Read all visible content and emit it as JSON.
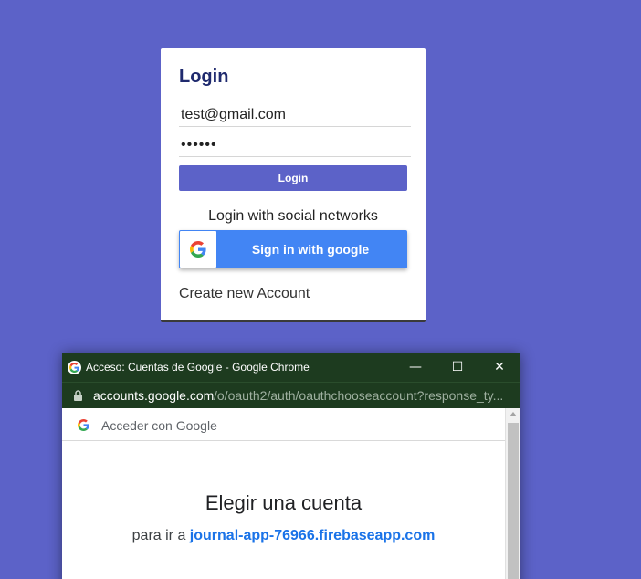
{
  "login_card": {
    "title": "Login",
    "email_value": "test@gmail.com",
    "password_value": "••••••",
    "login_button": "Login",
    "social_label": "Login with social networks",
    "google_button": "Sign in with google",
    "create_account": "Create new Account"
  },
  "popup": {
    "window_title": "Acceso: Cuentas de Google - Google Chrome",
    "minimize_glyph": "—",
    "maximize_glyph": "☐",
    "close_glyph": "✕",
    "url_domain": "accounts.google.com",
    "url_path": "/o/oauth2/auth/oauthchooseaccount?response_ty...",
    "header_text": "Acceder con Google",
    "choose_title": "Elegir una cuenta",
    "continue_prefix": "para ir a ",
    "continue_link": "journal-app-76966.firebaseapp.com"
  },
  "colors": {
    "background": "#5c62c8",
    "google_blue": "#4285f4",
    "chrome_titlebar": "#1d3b1f",
    "link_blue": "#1a73e8"
  },
  "icons": [
    "google-g-icon",
    "lock-icon",
    "minimize-icon",
    "maximize-icon",
    "close-icon",
    "scroll-up-arrow-icon"
  ]
}
